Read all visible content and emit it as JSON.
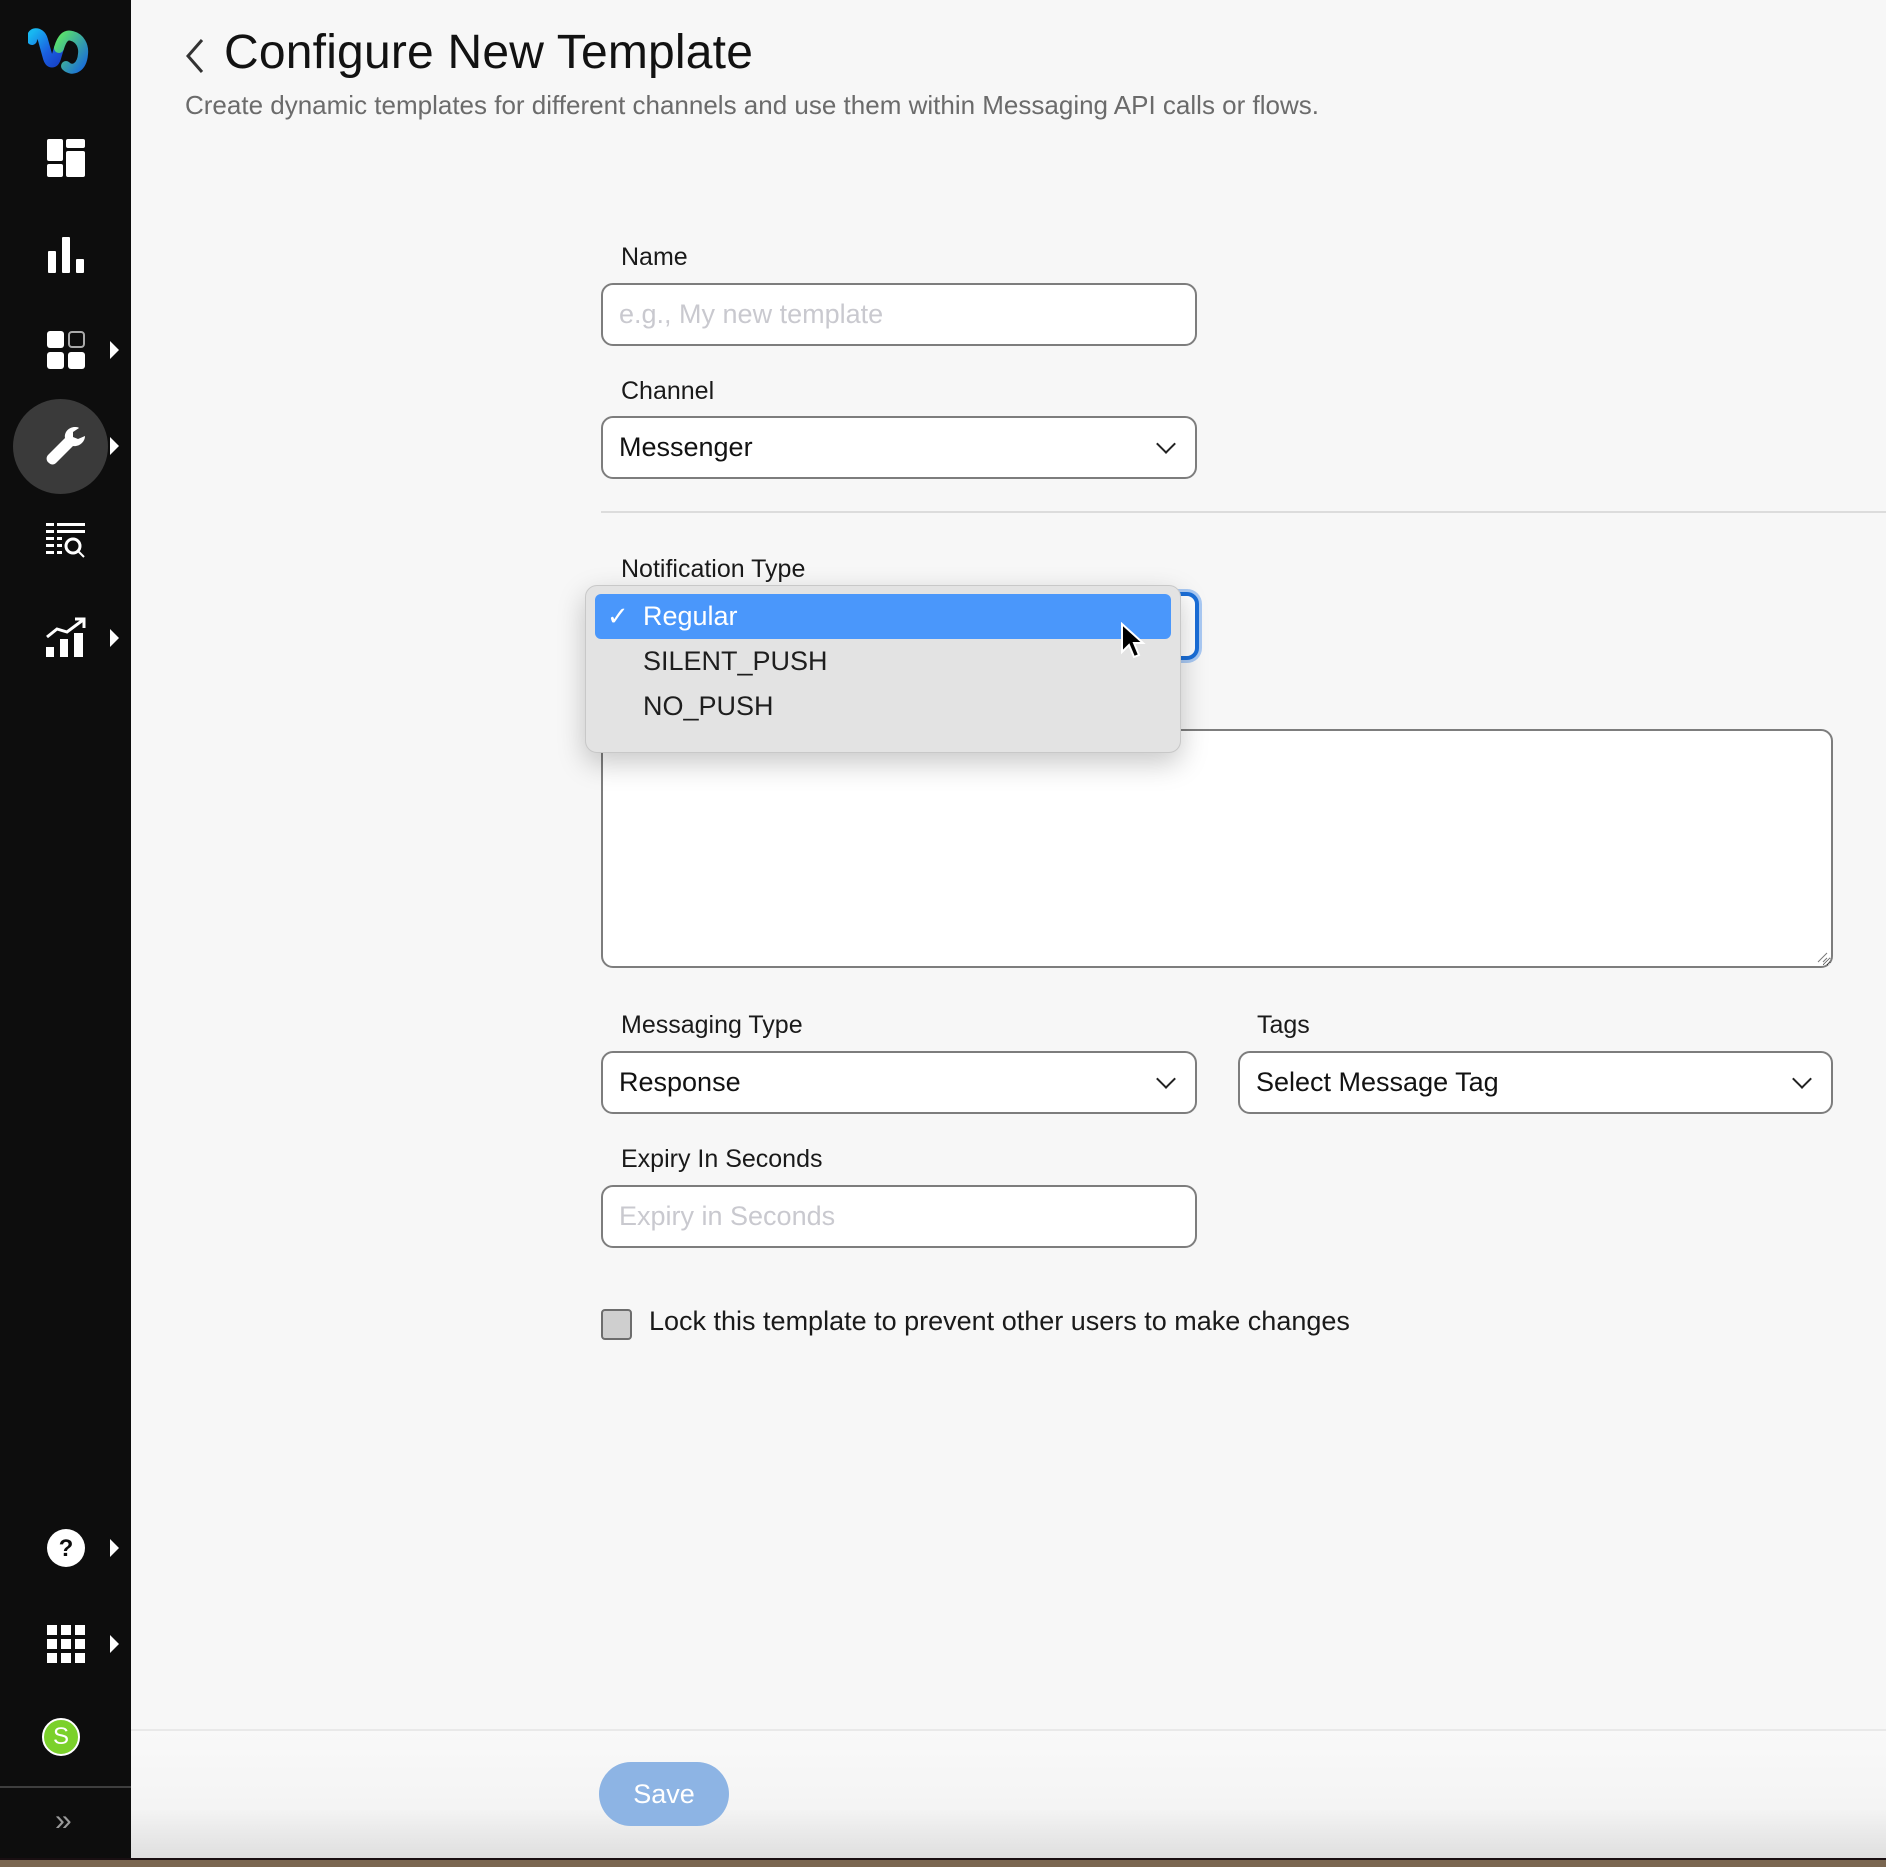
{
  "app": {
    "brand": "Webex",
    "brand_colors": {
      "logo_blue": "#1a6ed8",
      "logo_green": "#4bd07a",
      "accent": "#4a97fb"
    }
  },
  "sidebar": {
    "items": [
      {
        "icon": "dashboard-icon",
        "has_submenu": false,
        "active": false
      },
      {
        "icon": "bar-chart-icon",
        "has_submenu": false,
        "active": false
      },
      {
        "icon": "apps-grid-icon",
        "has_submenu": true,
        "active": false
      },
      {
        "icon": "wrench-icon",
        "has_submenu": true,
        "active": true
      },
      {
        "icon": "list-search-icon",
        "has_submenu": false,
        "active": false
      },
      {
        "icon": "growth-chart-icon",
        "has_submenu": true,
        "active": false
      }
    ],
    "bottom_items": [
      {
        "icon": "help-icon",
        "has_submenu": true
      },
      {
        "icon": "app-launcher-icon",
        "has_submenu": true
      }
    ],
    "avatar_initial": "S",
    "avatar_color": "#7bd12b",
    "expand_glyph": "»"
  },
  "header": {
    "title": "Configure New Template",
    "subtitle": "Create dynamic templates for different channels and use them within Messaging API calls or flows."
  },
  "form": {
    "name": {
      "label": "Name",
      "value": "",
      "placeholder": "e.g., My new template"
    },
    "channel": {
      "label": "Channel",
      "value": "Messenger"
    },
    "notification_type": {
      "label": "Notification Type",
      "value": "Regular",
      "options": [
        {
          "label": "Regular",
          "selected": true
        },
        {
          "label": "SILENT_PUSH",
          "selected": false
        },
        {
          "label": "NO_PUSH",
          "selected": false
        }
      ],
      "check_glyph": "✓"
    },
    "message_body": {
      "value": ""
    },
    "messaging_type": {
      "label": "Messaging Type",
      "value": "Response"
    },
    "tags": {
      "label": "Tags",
      "value": "Select Message Tag"
    },
    "expiry": {
      "label": "Expiry In Seconds",
      "value": "",
      "placeholder": "Expiry in Seconds"
    },
    "lock": {
      "label": "Lock this template to prevent other users to make changes",
      "checked": false
    }
  },
  "footer": {
    "save_label": "Save",
    "save_enabled": false
  }
}
